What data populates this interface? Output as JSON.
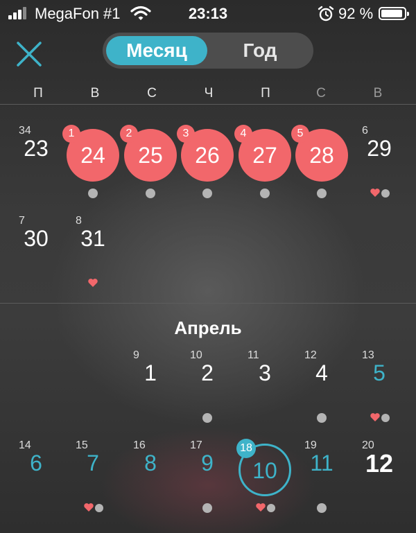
{
  "status_bar": {
    "carrier": "MegaFon #1",
    "time": "23:13",
    "battery_percent": "92 %",
    "battery_level": 0.92,
    "signal_bars": 3
  },
  "header": {
    "close_icon": "close-icon",
    "tabs": [
      {
        "label": "Месяц",
        "active": true
      },
      {
        "label": "Год",
        "active": false
      }
    ]
  },
  "weekdays": [
    "П",
    "В",
    "С",
    "Ч",
    "П",
    "С",
    "В"
  ],
  "colors": {
    "accent": "#3eb3c9",
    "period": "#f2676b",
    "background": "#333333",
    "dot": "#b4b4b4"
  },
  "march": {
    "weeks": [
      {
        "days": [
          {
            "col": 0,
            "week": "34",
            "day": "23"
          },
          {
            "col": 1,
            "day": "24",
            "period": "1",
            "dot": true
          },
          {
            "col": 2,
            "day": "25",
            "period": "2",
            "dot": true
          },
          {
            "col": 3,
            "day": "26",
            "period": "3",
            "dot": true
          },
          {
            "col": 4,
            "day": "27",
            "period": "4",
            "dot": true
          },
          {
            "col": 5,
            "day": "28",
            "period": "5",
            "dot": true
          },
          {
            "col": 6,
            "week": "6",
            "day": "29",
            "heart": true,
            "dot": true
          }
        ]
      },
      {
        "days": [
          {
            "col": 0,
            "week": "7",
            "day": "30"
          },
          {
            "col": 1,
            "week": "8",
            "day": "31",
            "heart": true
          }
        ]
      }
    ]
  },
  "april": {
    "title": "Апрель",
    "weeks": [
      {
        "days": [
          {
            "col": 2,
            "week": "9",
            "day": "1"
          },
          {
            "col": 3,
            "week": "10",
            "day": "2",
            "dot": true
          },
          {
            "col": 4,
            "week": "11",
            "day": "3"
          },
          {
            "col": 5,
            "week": "12",
            "day": "4",
            "dot": true
          },
          {
            "col": 6,
            "week": "13",
            "day": "5",
            "teal": true,
            "heart": true,
            "dot": true
          }
        ]
      },
      {
        "days": [
          {
            "col": 0,
            "week": "14",
            "day": "6",
            "teal": true
          },
          {
            "col": 1,
            "week": "15",
            "day": "7",
            "teal": true,
            "heart": true,
            "dot": true
          },
          {
            "col": 2,
            "week": "16",
            "day": "8",
            "teal": true
          },
          {
            "col": 3,
            "week": "17",
            "day": "9",
            "teal": true,
            "dot": true
          },
          {
            "col": 4,
            "day": "10",
            "today": true,
            "ring_badge": "18",
            "heart": true,
            "dot": true
          },
          {
            "col": 5,
            "week": "19",
            "day": "11",
            "teal": true,
            "dot": true
          },
          {
            "col": 6,
            "week": "20",
            "day": "12",
            "bold": true
          }
        ]
      }
    ]
  }
}
